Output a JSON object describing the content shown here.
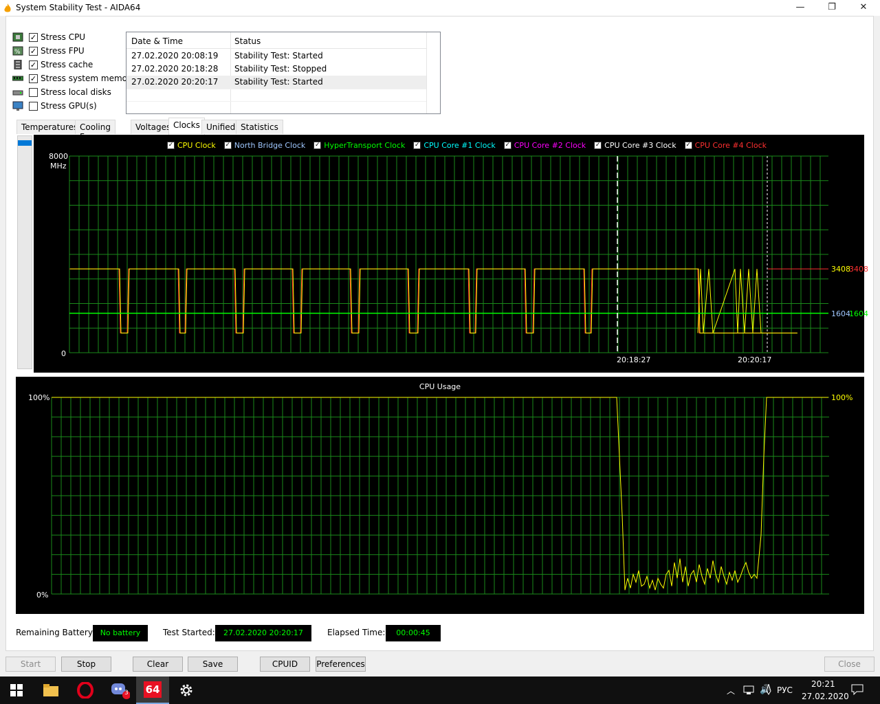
{
  "window": {
    "title": "System Stability Test - AIDA64",
    "minimize": "—",
    "maximize": "❐",
    "close": "✕"
  },
  "stress_options": [
    {
      "label": "Stress CPU",
      "checked": "✓",
      "icon": "cpu-icon"
    },
    {
      "label": "Stress FPU",
      "checked": "✓",
      "icon": "fpu-icon"
    },
    {
      "label": "Stress cache",
      "checked": "✓",
      "icon": "cache-icon"
    },
    {
      "label": "Stress system memory",
      "checked": "✓",
      "icon": "memory-icon"
    },
    {
      "label": "Stress local disks",
      "checked": "",
      "icon": "disk-icon"
    },
    {
      "label": "Stress GPU(s)",
      "checked": "",
      "icon": "gpu-icon"
    }
  ],
  "log": {
    "headers": [
      "Date & Time",
      "Status"
    ],
    "rows": [
      [
        "27.02.2020 20:08:19",
        "Stability Test: Started"
      ],
      [
        "27.02.2020 20:18:28",
        "Stability Test: Stopped"
      ],
      [
        "27.02.2020 20:20:17",
        "Stability Test: Started"
      ]
    ]
  },
  "tabs": [
    "Temperatures",
    "Cooling Fans",
    "Voltages",
    "Clocks",
    "Unified",
    "Statistics"
  ],
  "active_tab": "Clocks",
  "clock_chart": {
    "legend": [
      {
        "label": "CPU Clock",
        "color": "#ffff00"
      },
      {
        "label": "North Bridge Clock",
        "color": "#a0c8ff"
      },
      {
        "label": "HyperTransport Clock",
        "color": "#00ff00"
      },
      {
        "label": "CPU Core #1 Clock",
        "color": "#00ffff"
      },
      {
        "label": "CPU Core #2 Clock",
        "color": "#ff00ff"
      },
      {
        "label": "CPU Core #3 Clock",
        "color": "#ffffff"
      },
      {
        "label": "CPU Core #4 Clock",
        "color": "#ff3030"
      }
    ],
    "y_top": "8000",
    "y_unit": "MHz",
    "y_bottom": "0",
    "right_labels": [
      {
        "text": "3408",
        "color": "#ffff00"
      },
      {
        "text": "3408",
        "color": "#ff3030"
      },
      {
        "text": "1604",
        "color": "#a0c8ff"
      },
      {
        "text": "1604",
        "color": "#00ff00"
      }
    ],
    "time_labels": [
      "20:18:27",
      "20:20:17"
    ]
  },
  "usage_chart": {
    "title": "CPU Usage",
    "y_top": "100%",
    "y_bottom": "0%",
    "right_label": "100%"
  },
  "chart_data": [
    {
      "type": "line",
      "title": "",
      "ylabel": "MHz",
      "ylim": [
        0,
        8000
      ],
      "x": [
        "",
        "20:18:27",
        "20:20:17"
      ],
      "series": [
        {
          "name": "CPU Clock",
          "current": 3408,
          "color": "#ffff00"
        },
        {
          "name": "CPU Core #4 Clock",
          "current": 3408,
          "color": "#ff3030"
        },
        {
          "name": "North Bridge Clock",
          "current": 1604,
          "color": "#a0c8ff"
        },
        {
          "name": "HyperTransport Clock",
          "current": 1604,
          "color": "#00ff00"
        }
      ],
      "levels": {
        "high": 3408,
        "low": 800,
        "bridge": 1604
      }
    },
    {
      "type": "line",
      "title": "CPU Usage",
      "ylim": [
        0,
        100
      ],
      "series": [
        {
          "name": "",
          "current": 100,
          "color": "#ffff00"
        }
      ]
    }
  ],
  "status": {
    "battery_label": "Remaining Battery:",
    "battery_value": "No battery",
    "started_label": "Test Started:",
    "started_value": "27.02.2020 20:20:17",
    "elapsed_label": "Elapsed Time:",
    "elapsed_value": "00:00:45"
  },
  "buttons": {
    "start": "Start",
    "stop": "Stop",
    "clear": "Clear",
    "save": "Save",
    "cpuid": "CPUID",
    "preferences": "Preferences",
    "close": "Close"
  },
  "taskbar": {
    "lang": "РУС",
    "time": "20:21",
    "date": "27.02.2020",
    "badge": "3",
    "aida": "64"
  }
}
